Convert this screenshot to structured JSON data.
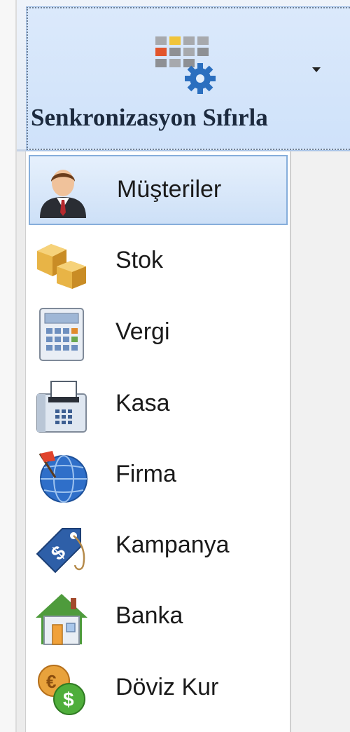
{
  "toolbar": {
    "sync_reset_label": "Senkronizasyon Sıfırla",
    "sync_reset_icon": "grid-gear-icon",
    "dropdown_icon": "chevron-down-icon"
  },
  "sidebar": {
    "selected_index": 0,
    "items": [
      {
        "label": "Müşteriler",
        "icon": "customer-icon"
      },
      {
        "label": "Stok",
        "icon": "boxes-icon"
      },
      {
        "label": "Vergi",
        "icon": "calculator-icon"
      },
      {
        "label": "Kasa",
        "icon": "cash-register-icon"
      },
      {
        "label": "Firma",
        "icon": "globe-flag-icon"
      },
      {
        "label": "Kampanya",
        "icon": "price-tag-icon"
      },
      {
        "label": "Banka",
        "icon": "house-icon"
      },
      {
        "label": "Döviz Kur",
        "icon": "currency-exchange-icon"
      }
    ]
  },
  "colors": {
    "ribbon_bg": "#cfe2fa",
    "selected_item_bg": "#d6e6f9",
    "selected_item_border": "#86aedb",
    "list_bg": "#ffffff"
  }
}
